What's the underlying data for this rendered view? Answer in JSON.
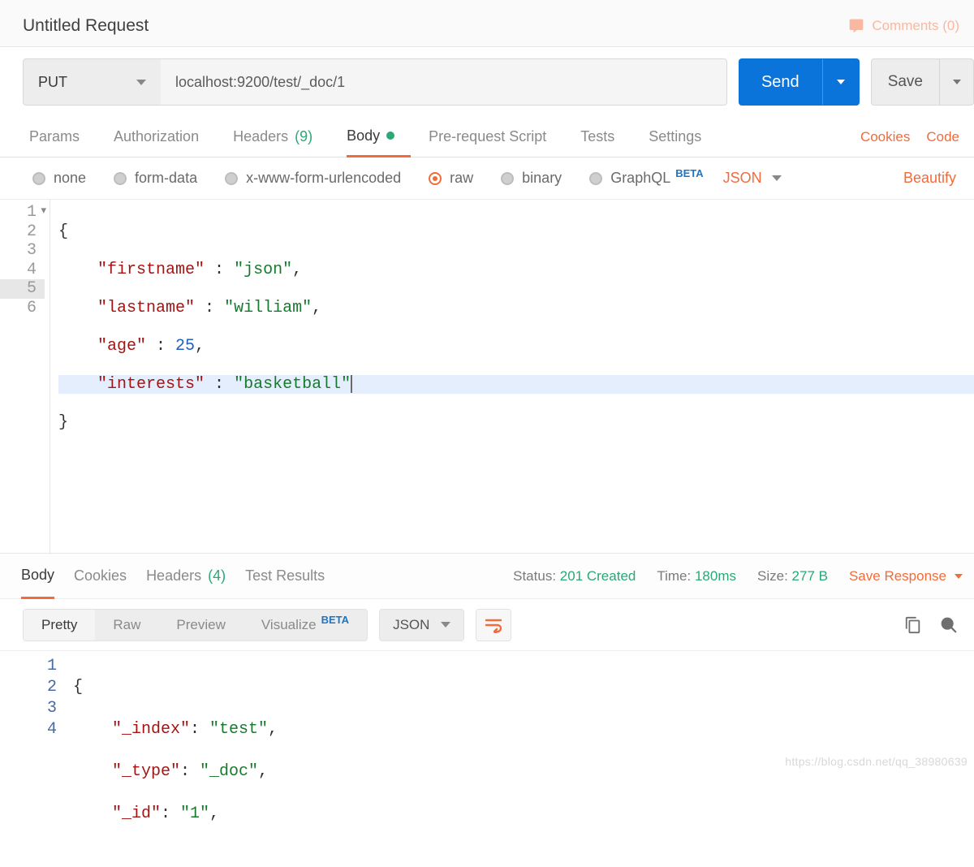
{
  "header": {
    "title": "Untitled Request",
    "comments_label": "Comments (0)"
  },
  "request": {
    "method": "PUT",
    "url": "localhost:9200/test/_doc/1",
    "send_label": "Send",
    "save_label": "Save"
  },
  "req_tabs": {
    "params": "Params",
    "authorization": "Authorization",
    "headers": "Headers",
    "headers_count": "(9)",
    "body": "Body",
    "prerequest": "Pre-request Script",
    "tests": "Tests",
    "settings": "Settings",
    "cookies": "Cookies",
    "code": "Code"
  },
  "body_types": {
    "none": "none",
    "form_data": "form-data",
    "xwww": "x-www-form-urlencoded",
    "raw": "raw",
    "binary": "binary",
    "graphql": "GraphQL",
    "beta": "BETA",
    "format": "JSON",
    "beautify": "Beautify"
  },
  "editor_request": {
    "lines": {
      "l1": "{",
      "l2_k": "\"firstname\"",
      "l2_v": "\"json\"",
      "l3_k": "\"lastname\"",
      "l3_v": "\"william\"",
      "l4_k": "\"age\"",
      "l4_v": "25",
      "l5_k": "\"interests\"",
      "l5_v": "\"basketball\"",
      "l6": "}"
    }
  },
  "resp_tabs": {
    "body": "Body",
    "cookies": "Cookies",
    "headers": "Headers",
    "headers_count": "(4)",
    "test_results": "Test Results"
  },
  "resp_meta": {
    "status_label": "Status:",
    "status_value": "201 Created",
    "time_label": "Time:",
    "time_value": "180ms",
    "size_label": "Size:",
    "size_value": "277 B",
    "save_response": "Save Response"
  },
  "resp_toolbar": {
    "pretty": "Pretty",
    "raw": "Raw",
    "preview": "Preview",
    "visualize": "Visualize",
    "beta": "BETA",
    "format": "JSON"
  },
  "editor_response": {
    "l1": "{",
    "l2_k": "\"_index\"",
    "l2_v": "\"test\"",
    "l3_k": "\"_type\"",
    "l3_v": "\"_doc\"",
    "l4_k": "\"_id\"",
    "l4_v": "\"1\""
  },
  "watermark": "https://blog.csdn.net/qq_38980639"
}
